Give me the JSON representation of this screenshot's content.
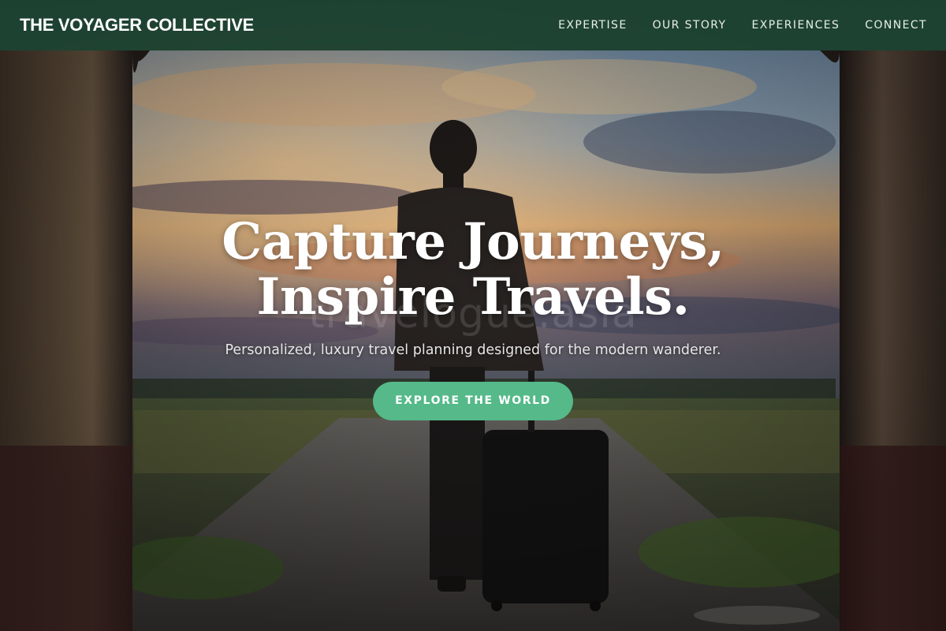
{
  "nav": {
    "brand": "THE VOYAGER COLLECTIVE",
    "links": [
      {
        "label": "EXPERTISE"
      },
      {
        "label": "OUR STORY"
      },
      {
        "label": "EXPERIENCES"
      },
      {
        "label": "CONNECT"
      }
    ]
  },
  "hero": {
    "title_line1": "Capture Journeys,",
    "title_line2": "Inspire Travels.",
    "subtitle": "Personalized, luxury travel planning designed for the modern wanderer.",
    "cta_label": "EXPLORE THE WORLD",
    "watermark": "travelogue.asia",
    "background_description_icon": "traveler-with-suitcase-photo"
  },
  "colors": {
    "navbar": "#1a402c",
    "cta": "#55b989",
    "text": "#ffffff"
  }
}
